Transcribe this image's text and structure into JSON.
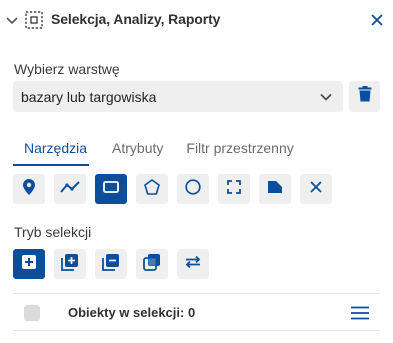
{
  "panel": {
    "title": "Selekcja, Analizy, Raporty",
    "icons": {
      "collapse": "chevron-down-icon",
      "selection": "selection-box-icon",
      "close": "close-icon"
    }
  },
  "layer": {
    "label": "Wybierz warstwę",
    "selected": "bazary lub targowiska",
    "delete_icon": "trash-icon"
  },
  "tabs": [
    {
      "label": "Narzędzia",
      "active": true
    },
    {
      "label": "Atrybuty",
      "active": false
    },
    {
      "label": "Filtr przestrzenny",
      "active": false
    }
  ],
  "tools": [
    {
      "icon": "point-icon",
      "active": false
    },
    {
      "icon": "polyline-icon",
      "active": false
    },
    {
      "icon": "rectangle-icon",
      "active": true
    },
    {
      "icon": "polygon-icon",
      "active": false
    },
    {
      "icon": "circle-icon",
      "active": false
    },
    {
      "icon": "extent-icon",
      "active": false
    },
    {
      "icon": "layer-shape-icon",
      "active": false
    },
    {
      "icon": "clear-icon",
      "active": false
    }
  ],
  "mode": {
    "label": "Tryb selekcji",
    "buttons": [
      {
        "icon": "new-selection-icon",
        "active": true
      },
      {
        "icon": "add-to-selection-icon",
        "active": false
      },
      {
        "icon": "remove-from-selection-icon",
        "active": false
      },
      {
        "icon": "intersect-selection-icon",
        "active": false
      },
      {
        "icon": "swap-selection-icon",
        "active": false
      }
    ]
  },
  "footer": {
    "count_text": "Obiekty w selekcji: 0",
    "menu_icon": "menu-icon"
  },
  "colors": {
    "accent": "#0b4f9c",
    "button_bg": "#efefef",
    "text": "#323232"
  }
}
